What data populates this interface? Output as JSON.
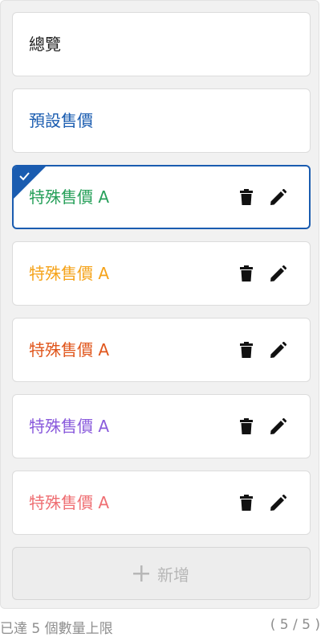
{
  "cards": [
    {
      "label": "總覽",
      "color": "#222222",
      "actions": false,
      "selected": false
    },
    {
      "label": "預設售價",
      "color": "#1a5cb0",
      "actions": false,
      "selected": false
    },
    {
      "label": "特殊售價 A",
      "color": "#27a05a",
      "actions": true,
      "selected": true
    },
    {
      "label": "特殊售價 A",
      "color": "#f5a31a",
      "actions": true,
      "selected": false
    },
    {
      "label": "特殊售價 A",
      "color": "#e0561c",
      "actions": true,
      "selected": false
    },
    {
      "label": "特殊售價 A",
      "color": "#8a5bdc",
      "actions": true,
      "selected": false
    },
    {
      "label": "特殊售價 A",
      "color": "#ef6f73",
      "actions": true,
      "selected": false
    }
  ],
  "add_button": {
    "label": "新增",
    "icon": "plus-icon"
  },
  "footer": {
    "limit_text": "已達 5 個數量上限",
    "count_text": "( 5 / 5 )"
  },
  "icons": {
    "delete": "trash-icon",
    "edit": "pencil-icon",
    "selected": "check-icon"
  },
  "colors": {
    "selected_border": "#1a5cb0"
  }
}
